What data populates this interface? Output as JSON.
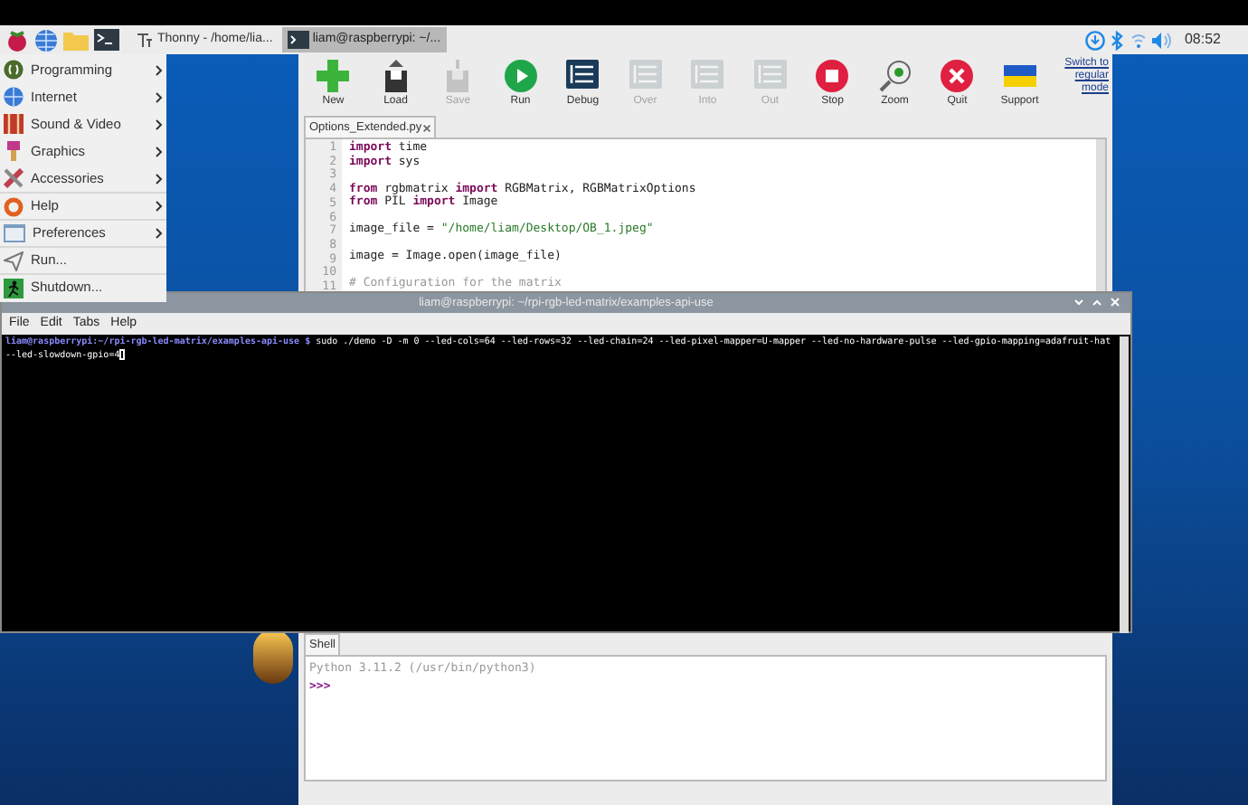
{
  "taskbar": {
    "tasks": [
      {
        "label": "Thonny - /home/lia...",
        "selected": false
      },
      {
        "label": "liam@raspberrypi: ~/...",
        "selected": true
      }
    ],
    "clock": "08:52"
  },
  "menu": {
    "items": [
      {
        "label": "Programming",
        "has_submenu": true
      },
      {
        "label": "Internet",
        "has_submenu": true
      },
      {
        "label": "Sound & Video",
        "has_submenu": true
      },
      {
        "label": "Graphics",
        "has_submenu": true
      },
      {
        "label": "Accessories",
        "has_submenu": true
      },
      {
        "label": "Help",
        "has_submenu": true
      },
      {
        "label": "Preferences",
        "has_submenu": true
      },
      {
        "label": "Run...",
        "has_submenu": false
      },
      {
        "label": "Shutdown...",
        "has_submenu": false
      }
    ]
  },
  "thonny": {
    "toolbar": [
      {
        "label": "New",
        "disabled": false
      },
      {
        "label": "Load",
        "disabled": false
      },
      {
        "label": "Save",
        "disabled": true
      },
      {
        "label": "Run",
        "disabled": false
      },
      {
        "label": "Debug",
        "disabled": false
      },
      {
        "label": "Over",
        "disabled": true
      },
      {
        "label": "Into",
        "disabled": true
      },
      {
        "label": "Out",
        "disabled": true
      },
      {
        "label": "Stop",
        "disabled": false
      },
      {
        "label": "Zoom",
        "disabled": false
      },
      {
        "label": "Quit",
        "disabled": false
      },
      {
        "label": "Support",
        "disabled": false
      }
    ],
    "mode_link": "Switch to regular mode",
    "editor_tab": "Options_Extended.py",
    "code": [
      {
        "number": "1",
        "tokens": [
          {
            "text": "import",
            "kind": "keyword"
          },
          {
            "text": " time",
            "kind": "plain"
          }
        ]
      },
      {
        "number": "2",
        "tokens": [
          {
            "text": "import",
            "kind": "keyword"
          },
          {
            "text": " sys",
            "kind": "plain"
          }
        ]
      },
      {
        "number": "3"
      },
      {
        "number": "4",
        "tokens": [
          {
            "text": "from",
            "kind": "keyword"
          },
          {
            "text": " rgbmatrix ",
            "kind": "plain"
          },
          {
            "text": "import",
            "kind": "keyword"
          },
          {
            "text": " RGBMatrix, RGBMatrixOptions",
            "kind": "plain"
          }
        ]
      },
      {
        "number": "5",
        "tokens": [
          {
            "text": "from",
            "kind": "keyword"
          },
          {
            "text": " PIL ",
            "kind": "plain"
          },
          {
            "text": "import",
            "kind": "keyword"
          },
          {
            "text": " Image",
            "kind": "plain"
          }
        ]
      },
      {
        "number": "6"
      },
      {
        "number": "7",
        "tokens": [
          {
            "text": "image_file = ",
            "kind": "plain"
          },
          {
            "text": "\"/home/liam/Desktop/OB_1.jpeg\"",
            "kind": "string"
          }
        ]
      },
      {
        "number": "8"
      },
      {
        "number": "9",
        "tokens": [
          {
            "text": "image = Image.open(image_file)",
            "kind": "plain"
          }
        ]
      },
      {
        "number": "10"
      },
      {
        "number": "11",
        "tokens": [
          {
            "text": "# Configuration for the matrix",
            "kind": "comment"
          }
        ]
      }
    ],
    "shell_tab": "Shell",
    "shell_banner": "Python 3.11.2 (/usr/bin/python3)",
    "shell_prompt": ">>>"
  },
  "terminal": {
    "title": "liam@raspberrypi: ~/rpi-rgb-led-matrix/examples-api-use",
    "menu": [
      "File",
      "Edit",
      "Tabs",
      "Help"
    ],
    "prompt": "liam@raspberrypi:~/rpi-rgb-led-matrix/examples-api-use $",
    "command": "sudo ./demo -D -m 0 --led-cols=64 --led-rows=32 --led-chain=24 --led-pixel-mapper=U-mapper --led-no-hardware-pulse --led-gpio-mapping=adafruit-hat --led-slowdown-gpio=4"
  }
}
